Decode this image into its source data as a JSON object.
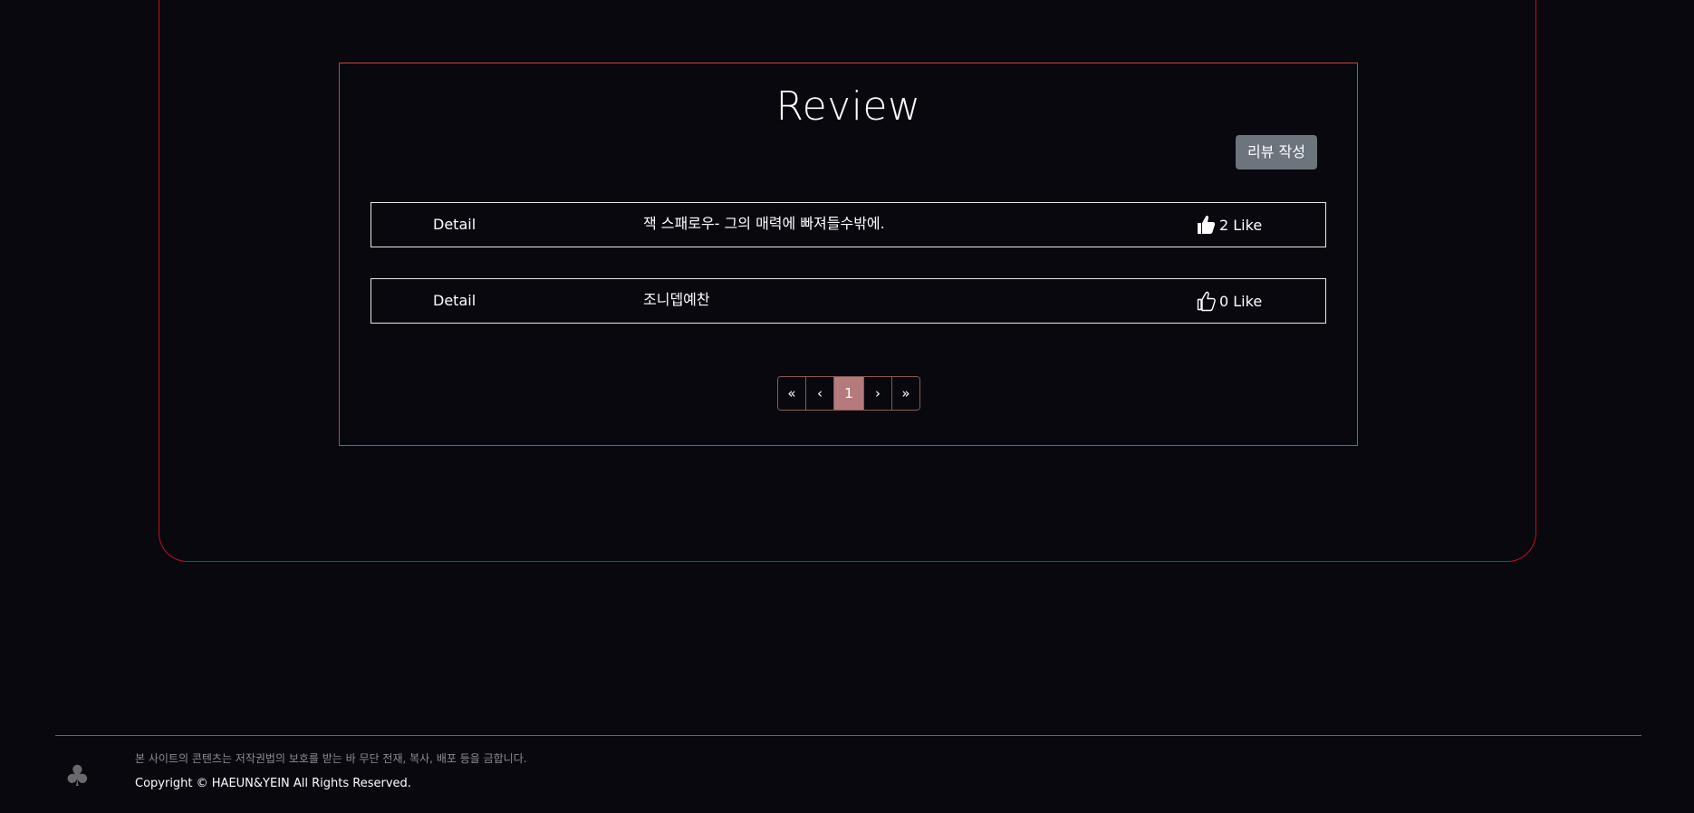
{
  "review_section": {
    "title": "Review",
    "write_button_label": "리뷰 작성",
    "rows": [
      {
        "detail_label": "Detail",
        "text": "잭 스패로우- 그의 매력에 빠져들수밖에.",
        "like_label": "2 Like",
        "liked": true
      },
      {
        "detail_label": "Detail",
        "text": "조니뎁예찬",
        "like_label": "0 Like",
        "liked": false
      }
    ]
  },
  "pagination": {
    "first": "«",
    "prev": "‹",
    "current": "1",
    "next": "›",
    "last": "»"
  },
  "footer": {
    "icon": "club-icon",
    "notice": "본 사이트의 콘텐츠는 저작권법의 보호를 받는 바 무단 전재, 복사, 배포 등을 금합니다.",
    "copyright": "Copyright © HAEUN&YEIN All Rights Reserved."
  },
  "colors": {
    "background": "#09080f",
    "frame_border": "#c0101c",
    "panel_border": "#c8453e",
    "button_gray": "#6c747c",
    "page_active": "#b47a7c"
  }
}
